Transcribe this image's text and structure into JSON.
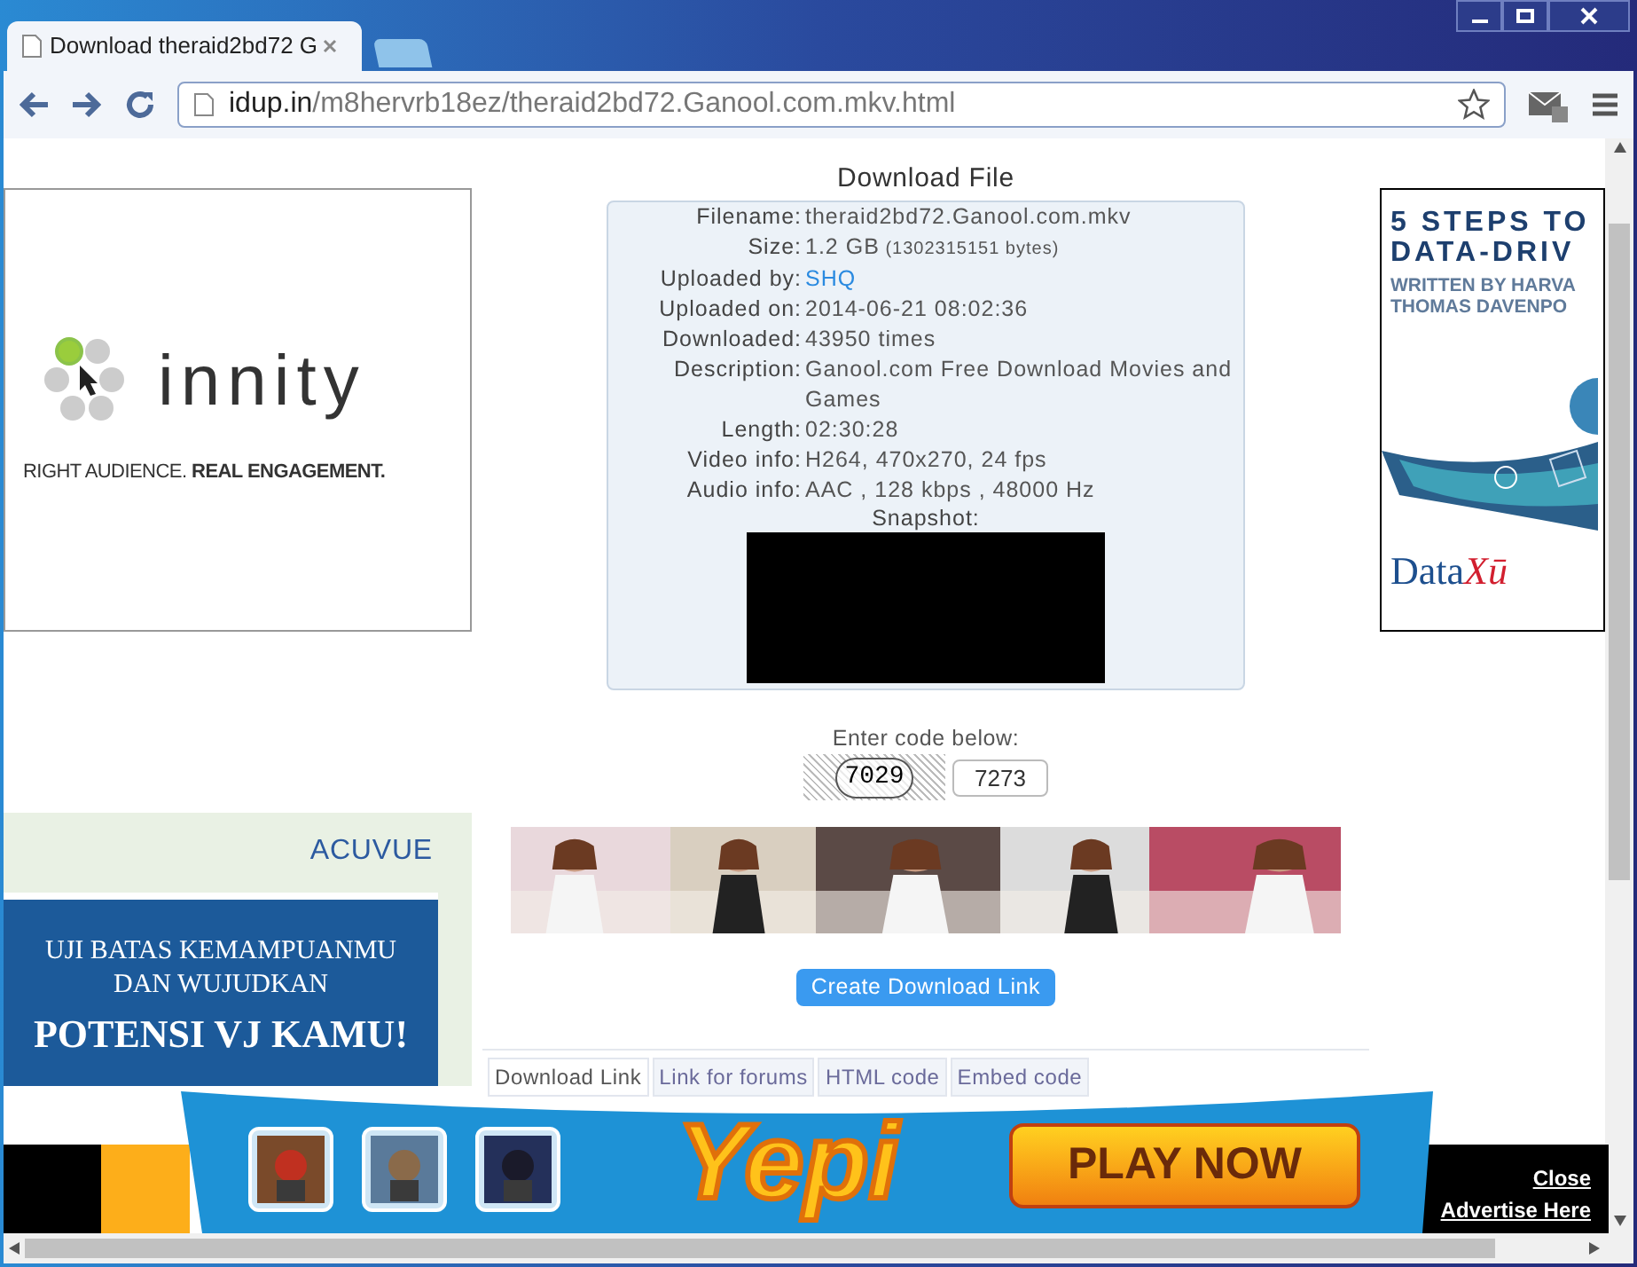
{
  "browser": {
    "tabs": [
      {
        "kind": "page",
        "title": "Download theraid2bd72 G",
        "selected": true
      },
      {
        "kind": "new",
        "selected": false
      }
    ],
    "url_host": "idup.in",
    "url_path": "/m8hervrb18ez/theraid2bd72.Ganool.com.mkv.html"
  },
  "left_ad": {
    "brand": "innity",
    "tagline_plain": "RIGHT AUDIENCE. ",
    "tagline_bold": "REAL ENGAGEMENT."
  },
  "file_panel": {
    "title": "Download File",
    "rows": [
      {
        "label": "Filename:",
        "value": "theraid2bd72.Ganool.com.mkv",
        "kind": "text"
      },
      {
        "label": "Size:",
        "value": "1.2 GB",
        "extra": "(1302315151 bytes)",
        "kind": "text"
      },
      {
        "label": "Uploaded by:",
        "value": "SHQ",
        "kind": "link"
      },
      {
        "label": "Uploaded on:",
        "value": "2014-06-21 08:02:36",
        "kind": "text"
      },
      {
        "label": "Downloaded:",
        "value": "43950 times",
        "kind": "text"
      },
      {
        "label": "Description:",
        "value": "Ganool.com Free Download Movies and Games",
        "kind": "text"
      },
      {
        "label": "Length:",
        "value": "02:30:28",
        "kind": "text"
      },
      {
        "label": "Video info:",
        "value": "H264, 470x270, 24 fps",
        "kind": "text"
      },
      {
        "label": "Audio info:",
        "value": "AAC , 128 kbps , 48000 Hz",
        "kind": "text"
      }
    ],
    "snapshot_label": "Snapshot:"
  },
  "captcha": {
    "prompt": "Enter code below:",
    "image_code": "7029",
    "input_value": "7273"
  },
  "create_button": "Create Download Link",
  "link_tabs": [
    {
      "label": "Download Link",
      "selected": true
    },
    {
      "label": "Link for forums",
      "selected": false
    },
    {
      "label": "HTML code",
      "selected": false
    },
    {
      "label": "Embed code",
      "selected": false
    }
  ],
  "right_ad": {
    "headline_1": "5 STEPS TO",
    "headline_2": "DATA-DRIV",
    "byline_1": "WRITTEN BY HARVA",
    "byline_2": "THOMAS DAVENPO",
    "logo_a": "Data",
    "logo_b": "Xū"
  },
  "acuvue_ad": {
    "brand": "ACUVUE",
    "line_1": "UJI BATAS KEMAMPUANMU",
    "line_2": "DAN WUJUDKAN",
    "line_3": "POTENSI VJ KAMU!"
  },
  "bottom_banner": {
    "logo": "Yepi",
    "play_button": "PLAY NOW",
    "close_link": "Close",
    "advertise_link": "Advertise Here"
  }
}
